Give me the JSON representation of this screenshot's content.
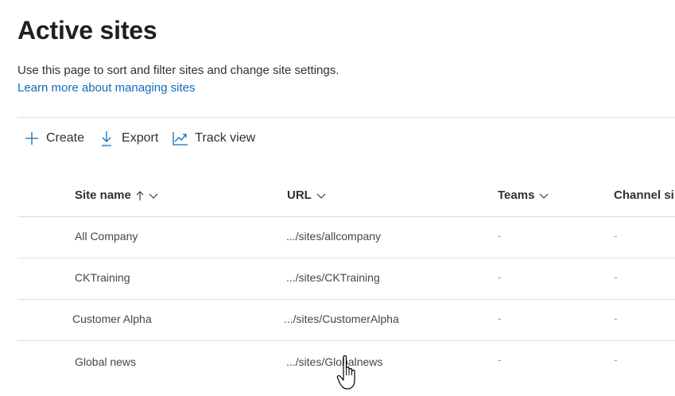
{
  "page": {
    "title": "Active sites",
    "description": "Use this page to sort and filter sites and change site settings.",
    "learn_link": "Learn more about managing sites"
  },
  "toolbar": {
    "create_label": "Create",
    "create_icon": "plus-icon",
    "export_label": "Export",
    "export_icon": "download-icon",
    "track_label": "Track view",
    "track_icon": "line-chart-icon"
  },
  "table": {
    "columns": [
      {
        "label": "Site name",
        "sort": "ascending",
        "has_menu": true
      },
      {
        "label": "URL",
        "has_menu": true
      },
      {
        "label": "Teams",
        "has_menu": true
      },
      {
        "label": "Channel si",
        "has_menu": false
      }
    ],
    "rows": [
      {
        "site_name": "All Company",
        "url": ".../sites/allcompany",
        "teams": "-",
        "channel": "-"
      },
      {
        "site_name": "CKTraining",
        "url": ".../sites/CKTraining",
        "teams": "-",
        "channel": "-"
      },
      {
        "site_name": "Customer Alpha",
        "url": ".../sites/CustomerAlpha",
        "teams": "-",
        "channel": "-"
      },
      {
        "site_name": "Global news",
        "url": ".../sites/Globalnews",
        "teams": "-",
        "channel": "-"
      }
    ]
  },
  "colors": {
    "link": "#0f6cbd",
    "accent_icon": "#0f6cbd",
    "divider": "#e1dfdd"
  }
}
